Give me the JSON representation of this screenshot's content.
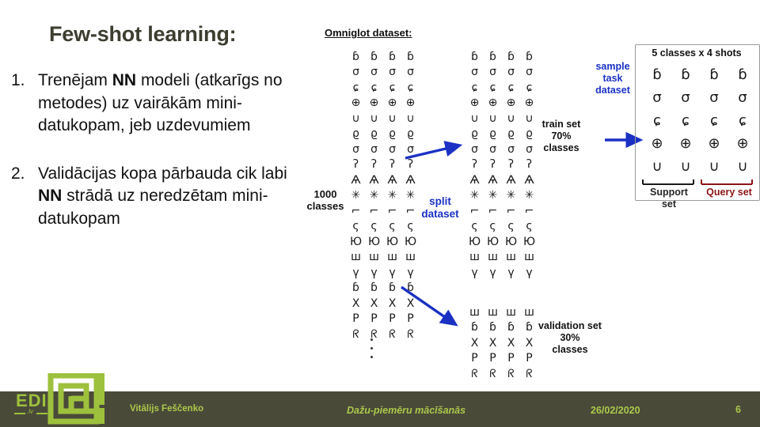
{
  "slide": {
    "title": "Few-shot learning:",
    "title_color": "#3d3d30",
    "bullets": [
      {
        "number": "1.",
        "pre": "Trenējam ",
        "bold": "NN",
        "post": " modeli (atkarīgs no metodes) uz vairākām mini-datukopam, jeb uzdevumiem"
      },
      {
        "number": "2.",
        "pre": "Validācijas kopa pārbauda cik labi ",
        "bold": "NN",
        "post": " strādā uz neredzētam mini-datukopam"
      }
    ]
  },
  "diagram": {
    "omniglot_title": "Omniglot dataset:",
    "classes_count_line1": "1000",
    "classes_count_line2": "classes",
    "split_line1": "split",
    "split_line2": "dataset",
    "train_line1": "train set",
    "train_line2": "70%",
    "train_line3": "classes",
    "validation_line1": "validation set",
    "validation_line2": "30%",
    "validation_line3": "classes",
    "sample_line1": "sample",
    "sample_line2": "task",
    "sample_line3": "dataset",
    "shots_label": "5 classes x 4 shots",
    "support_line1": "Support",
    "support_line2": "set",
    "query_label": "Query set",
    "arrow_color": "#1b31c4",
    "blue_text_color": "#1b31c4",
    "red_text_color": "#8c1416",
    "glyph_color": "#1a1a1a",
    "source_glyph_rows": [
      "ɓ ɓ ɓ ɓ",
      "σ σ σ σ",
      "ɕ ɕ ɕ ɕ",
      "⊕ ⊕ ⊕ ⊕",
      "∪ ∪ ∪ ∪",
      "ϱ ϱ ϱ ϱ",
      "σ σ σ σ",
      "ʔ ʔ ʔ ʔ",
      "Ѧ Ѧ Ѧ Ѧ",
      "✳ ✳ ✳ ✳",
      "⌐ ⌐ ⌐ ⌐",
      "ς ς ς ς",
      "Ю Ю Ю Ю",
      "ш ш ш ш",
      "ү ү ү ү",
      "ɓ ɓ ɓ ɓ",
      "X X X X",
      "P P P P",
      "ᖇ ᖇ ᖇ ᖇ"
    ],
    "train_glyph_rows": [
      "ɓ ɓ ɓ ɓ",
      "σ σ σ σ",
      "ɕ ɕ ɕ ɕ",
      "⊕ ⊕ ⊕ ⊕",
      "∪ ∪ ∪ ∪",
      "ϱ ϱ ϱ ϱ",
      "σ σ σ σ",
      "ʔ ʔ ʔ ʔ",
      "Ѧ Ѧ Ѧ Ѧ",
      "✳ ✳ ✳ ✳",
      "⌐ ⌐ ⌐ ⌐",
      "ς ς ς ς",
      "Ю Ю Ю Ю",
      "ш ш ш ш",
      "ү ү ү ү"
    ],
    "validation_glyph_rows": [
      "ш ш ш ш",
      "ɓ ɓ ɓ ɓ",
      "X X X X",
      "P P P P",
      "ᖇ ᖇ ᖇ ᖇ"
    ],
    "task_glyph_rows": [
      "ɓ ɓ ɓ ɓ",
      "σ σ σ σ",
      "ɕ ɕ ɕ ɕ",
      "⊕ ⊕ ⊕ ⊕",
      "∪ ∪ ∪ ∪"
    ]
  },
  "footer": {
    "author": "Vitālijs Feščenko",
    "topic": "Dažu-piemēru mācīšanās",
    "date": "26/02/2020",
    "page": "6",
    "bar_color": "#4a4a39",
    "text_color": "#aac94a",
    "logo_text": "EDI",
    "logo_domain": ".lv"
  }
}
